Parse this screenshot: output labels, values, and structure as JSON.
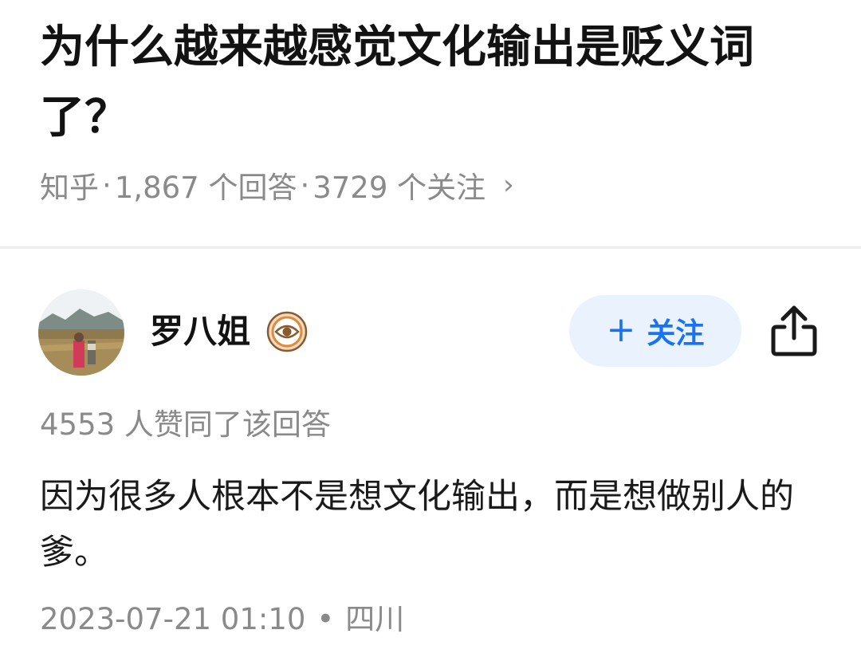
{
  "question": {
    "title": "为什么越来越感觉文化输出是贬义词了？",
    "source": "知乎",
    "answers_count": "1,867 个回答",
    "followers_count": "3729 个关注"
  },
  "author": {
    "name": "罗八姐",
    "badge_icon": "eye-badge-icon",
    "follow_label": "关注"
  },
  "answer": {
    "vote_text": "4553 人赞同了该回答",
    "content": "因为很多人根本不是想文化输出，而是想做别人的爹。",
    "timestamp": "2023-07-21 01:10",
    "location": "四川"
  },
  "colors": {
    "accent": "#1772f6",
    "follow_bg": "#eaf2fd",
    "muted_text": "#8a8a8a",
    "badge": "#e08a3c"
  }
}
